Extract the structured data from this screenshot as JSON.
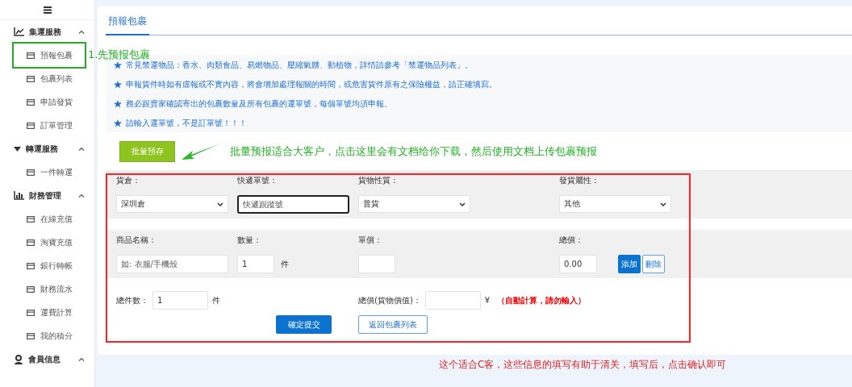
{
  "sidebar": {
    "groups": [
      {
        "title": "集運服務",
        "expanded": true,
        "items": [
          {
            "label": "預報包裹",
            "annotated": true
          },
          {
            "label": "包裹列表",
            "annotated": false
          },
          {
            "label": "申請發貨",
            "annotated": false
          },
          {
            "label": "訂單管理",
            "annotated": false
          }
        ]
      },
      {
        "title": "轉運服務",
        "expanded": true,
        "items": [
          {
            "label": "一件轉運",
            "annotated": false
          }
        ]
      },
      {
        "title": "財務管理",
        "expanded": true,
        "items": [
          {
            "label": "在線充值",
            "annotated": false
          },
          {
            "label": "淘寶充值",
            "annotated": false
          },
          {
            "label": "銀行轉帳",
            "annotated": false
          },
          {
            "label": "財務流水",
            "annotated": false
          },
          {
            "label": "運費計算",
            "annotated": false
          },
          {
            "label": "我的積分",
            "annotated": false
          }
        ]
      },
      {
        "title": "會員信息",
        "expanded": true
      }
    ]
  },
  "tabs": [
    {
      "label": "預報包裹",
      "selected": true
    }
  ],
  "notices": [
    "常見禁運物品：香水、肉類食品、易燃物品、壓縮氣體、動植物，詳情請參考「禁運物品列表」。",
    "申報貨件時如有虛報或不實內容，將會增加處理報關的時間，或危害貨件原有之保險權益，請正確填寫。",
    "務必跟賣家確認寄出的包裹數量及所有包裹的運單號，每個單號均須申報。",
    "請輸入運單號，不是訂單號！！！"
  ],
  "batch_button": "批量預存",
  "form": {
    "rows": [
      {
        "fields": [
          {
            "label": "貨倉：",
            "kind": "select",
            "value": "深圳倉"
          },
          {
            "label": "快遞單號：",
            "kind": "input",
            "placeholder": "快遞跟蹤號",
            "focused": true
          },
          {
            "label": "貨物性質：",
            "kind": "select",
            "value": "普貨"
          },
          {
            "label": "發貨屬性：",
            "kind": "select",
            "value": "其他"
          }
        ]
      },
      {
        "fields": [
          {
            "label": "商品名稱：",
            "kind": "input",
            "placeholder": "如: 衣服/手機殼",
            "focused": false
          },
          {
            "label": "數量：",
            "kind": "short-input",
            "value": "1",
            "unit": "件"
          },
          {
            "label": "單價：",
            "kind": "short-input"
          },
          {
            "label": "總價：",
            "kind": "short-input",
            "value": "0.00",
            "actions": [
              {
                "label": "添加",
                "primary": true
              },
              {
                "label": "刪除",
                "primary": false
              }
            ]
          }
        ]
      }
    ],
    "total_count": {
      "label": "總件數：",
      "value": "1",
      "unit": "件"
    },
    "total_value": {
      "label": "總價(貨物價值)：",
      "unit": "¥",
      "note": "（自動計算，請勿輸入）"
    },
    "buttons": [
      {
        "label": "確定提交",
        "primary": true
      },
      {
        "label": "返回包裹列表",
        "primary": false
      }
    ]
  },
  "annotations": {
    "sidebar_note": "1.先预报包裹",
    "batch_note": "批量预报适合大客户，点击这里会有文档给你下载，然后使用文档上传包裹预报",
    "form_note": "这个适合C客，这些信息的填写有助于清关，填写后，点击确认即可"
  }
}
